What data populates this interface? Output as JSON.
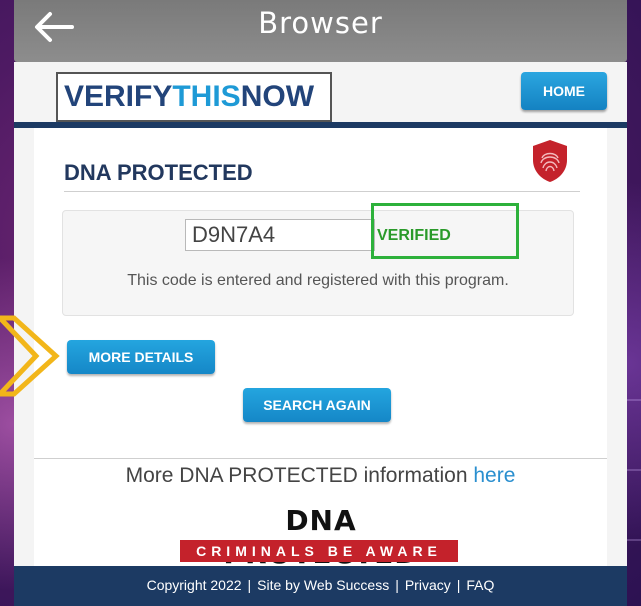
{
  "browser": {
    "title": "Browser"
  },
  "site": {
    "logo": {
      "part1": "VERIFY",
      "part2": "THIS",
      "part3": "NOW"
    },
    "nav": {
      "home": "HOME"
    }
  },
  "verify": {
    "heading": "DNA PROTECTED",
    "code_value": "D9N7A4",
    "status": "VERIFIED",
    "note": "This code is entered and registered with this program.",
    "more_details": "MORE DETAILS",
    "search_again": "SEARCH AGAIN"
  },
  "info": {
    "text": "More DNA PROTECTED information ",
    "link": "here"
  },
  "brand_logo": {
    "line1": "DNA PROTECTED",
    "line2": "CRIMINALS BE AWARE"
  },
  "footer": {
    "copyright": "Copyright 2022",
    "site_by": "Site by Web Success",
    "privacy": "Privacy",
    "faq": "FAQ",
    "separator": "|"
  },
  "colors": {
    "header_navy": "#1c3a63",
    "button_blue": "#1e9ad6",
    "verified_green": "#2a9a2a",
    "highlight_green": "#2db13b",
    "arrow_yellow": "#f2b61a",
    "brand_red": "#c4222b"
  },
  "icons": [
    "back-arrow-icon",
    "shield-icon",
    "pointer-arrow-icon"
  ]
}
